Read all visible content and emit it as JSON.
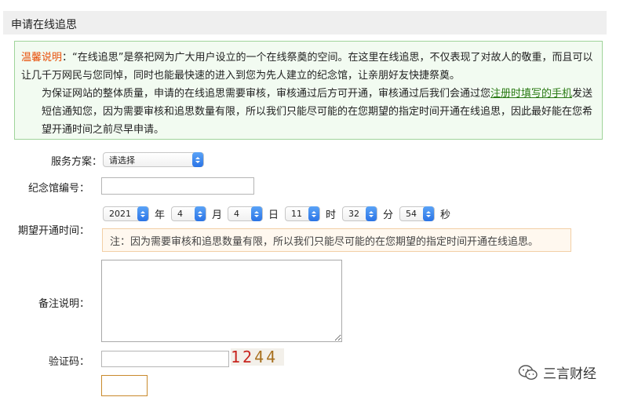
{
  "section_title": "申请在线追思",
  "notice": {
    "lead": "温馨说明",
    "p1_rest": "：“在线追思”是祭祀网为广大用户设立的一个在线祭奠的空间。在这里在线追思，不仅表现了对故人的敬重，而且可以让几千万网民与您同悼，同时也能最快速的进入到您为先人建立的纪念馆，让亲朋好友快捷祭奠。",
    "p2_before": "为保证网站的整体质量，申请的在线追思需要审核，审核通过后方可开通，审核通过后我们会通过您",
    "p2_link": "注册时填写的手机",
    "p2_after": "发送短信通知您，因为需要审核和追思数量有限，所以我们只能尽可能的在您期望的指定时间开通在线追思，因此最好能在您希望开通时间之前尽早申请。"
  },
  "form": {
    "service_label": "服务方案：",
    "service_value": "请选择",
    "hall_label": "纪念馆编号：",
    "time_label": "期望开通时间：",
    "year_value": "2021",
    "year_unit": "年",
    "month_value": "4",
    "month_unit": "月",
    "day_value": "4",
    "day_unit": "日",
    "hour_value": "11",
    "hour_unit": "时",
    "minute_value": "32",
    "minute_unit": "分",
    "second_value": "54",
    "second_unit": "秒",
    "time_hint": "注：因为需要审核和追思数量有限，所以我们只能尽可能的在您期望的指定时间开通在线追思。",
    "remark_label": "备注说明：",
    "captcha_label": "验证码：",
    "captcha_digits": [
      "1",
      "2",
      "4",
      "4"
    ]
  },
  "watermark": {
    "text": "三言财经",
    "icon": "wechat-icon"
  },
  "colors": {
    "notice_lead": "#e8500a",
    "notice_link": "#2a7a14",
    "notice_border": "#9fd49a",
    "hint_border": "#f2cfa6",
    "select_arrow": "#2b74e6"
  }
}
